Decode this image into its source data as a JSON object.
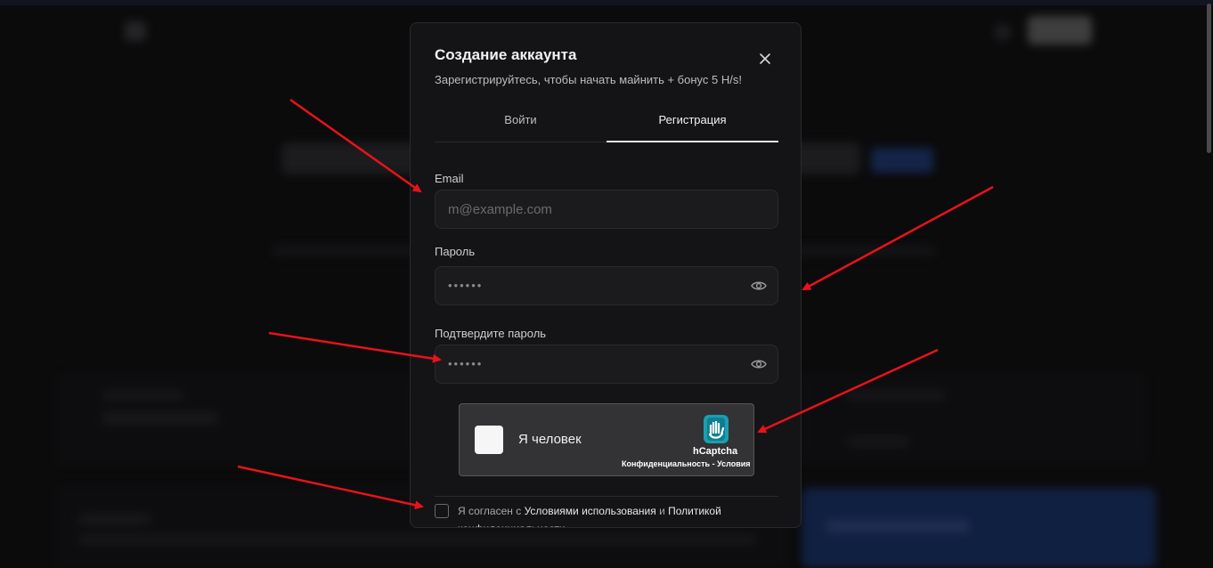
{
  "modal": {
    "title": "Создание аккаунта",
    "subtitle": "Зарегистрируйтесь, чтобы начать майнить + бонус 5 H/s!"
  },
  "tabs": {
    "login": "Войти",
    "register": "Регистрация",
    "active": "register"
  },
  "form": {
    "email_label": "Email",
    "email_placeholder": "m@example.com",
    "password_label": "Пароль",
    "password_value": "••••••",
    "confirm_label": "Подтвердите пароль",
    "confirm_value": "••••••"
  },
  "captcha": {
    "label": "Я человек",
    "brand": "hCaptcha",
    "privacy": "Конфиденциальность",
    "separator": " - ",
    "terms": "Условия"
  },
  "agreement": {
    "prefix": "Я согласен с ",
    "terms_link": "Условиями использования",
    "middle": " и ",
    "privacy_link": "Политикой конфиденциальности"
  },
  "colors": {
    "annotation_arrow": "#e8121b",
    "captcha_logo": "#1a9fb0"
  },
  "icons": {
    "close": "close-icon",
    "eye": "eye-icon",
    "captcha": "hcaptcha-logo-icon"
  }
}
